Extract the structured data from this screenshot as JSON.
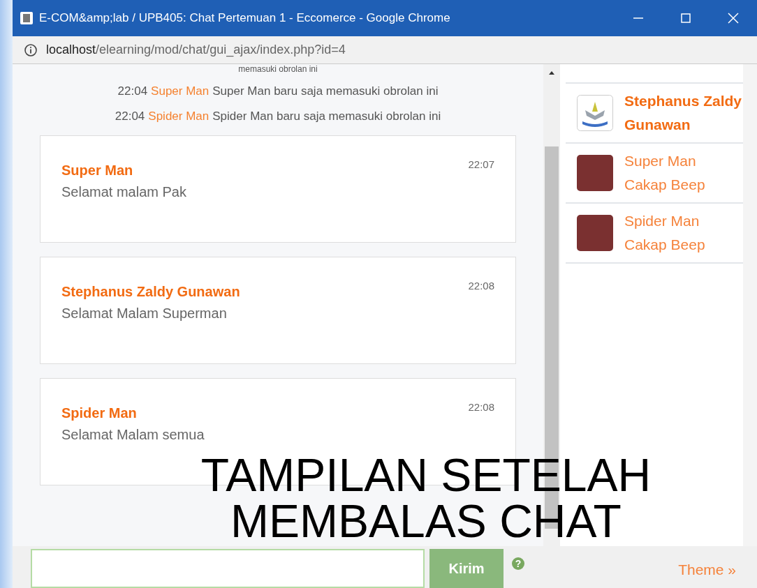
{
  "window": {
    "title": "E-COM&amp;lab / UPB405: Chat Pertemuan 1 - Eccomerce - Google Chrome"
  },
  "address_bar": {
    "host": "localhost",
    "path": "/elearning/mod/chat/gui_ajax/index.php?id=4"
  },
  "chat": {
    "system_messages": [
      {
        "text": "memasuki obrolan ini"
      },
      {
        "time": "22:04",
        "user": "Super Man",
        "text": "Super Man baru saja memasuki obrolan ini"
      },
      {
        "time": "22:04",
        "user": "Spider Man",
        "text": "Spider Man baru saja memasuki obrolan ini"
      }
    ],
    "messages": [
      {
        "user": "Super Man",
        "time": "22:07",
        "text": "Selamat malam Pak"
      },
      {
        "user": "Stephanus Zaldy Gunawan",
        "time": "22:08",
        "text": "Selamat Malam Superman"
      },
      {
        "user": "Spider Man",
        "time": "22:08",
        "text": "Selamat Malam semua"
      }
    ]
  },
  "users": [
    {
      "name": "Stephanus Zaldy Gunawan",
      "current": true,
      "kind": "logo"
    },
    {
      "name": "Super Man",
      "current": false,
      "kind": "photo",
      "action": "Cakap Beep"
    },
    {
      "name": "Spider Man",
      "current": false,
      "kind": "photo",
      "action": "Cakap Beep"
    }
  ],
  "input_bar": {
    "button": "Kirim",
    "help": "?",
    "theme_link": "Theme »"
  },
  "caption": [
    "TAMPILAN SETELAH",
    "MEMBALAS CHAT"
  ]
}
